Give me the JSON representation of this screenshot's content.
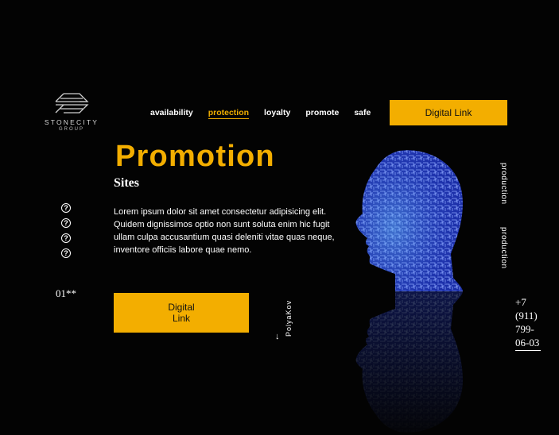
{
  "brand": {
    "name": "STONECITY",
    "sub": "GROUP"
  },
  "nav": {
    "items": [
      {
        "label": "availability",
        "active": false
      },
      {
        "label": "protection",
        "active": true
      },
      {
        "label": "loyalty",
        "active": false
      },
      {
        "label": "promote",
        "active": false
      },
      {
        "label": "safe",
        "active": false
      }
    ]
  },
  "header": {
    "cta_label": "Digital Link"
  },
  "hero": {
    "title": "Promotion",
    "subtitle": "Sites",
    "paragraph": "Lorem ipsum dolor sit amet consectetur adipisicing elit. Quidem dignissimos optio non sunt soluta enim hic fugit ullam culpa accusantium quasi deleniti vitae quas neque, inventore officiis labore quae nemo.",
    "cta_line1": "Digital",
    "cta_line2": "Link"
  },
  "side": {
    "icons": [
      "?",
      "?",
      "?",
      "?"
    ],
    "counter": "01**"
  },
  "author": {
    "name": "PolyaKov",
    "arrow": "↓"
  },
  "right": {
    "vertical_1": "production",
    "vertical_2": "production",
    "phone": "+7 (911) 799-06-03"
  },
  "colors": {
    "accent": "#f3ae00",
    "background": "#030303",
    "text": "#ffffff",
    "head": "#3f56e6"
  },
  "icons": {
    "logo": "stonecity-logo-icon",
    "question": "question-circle-icon",
    "head": "digital-head-image"
  }
}
